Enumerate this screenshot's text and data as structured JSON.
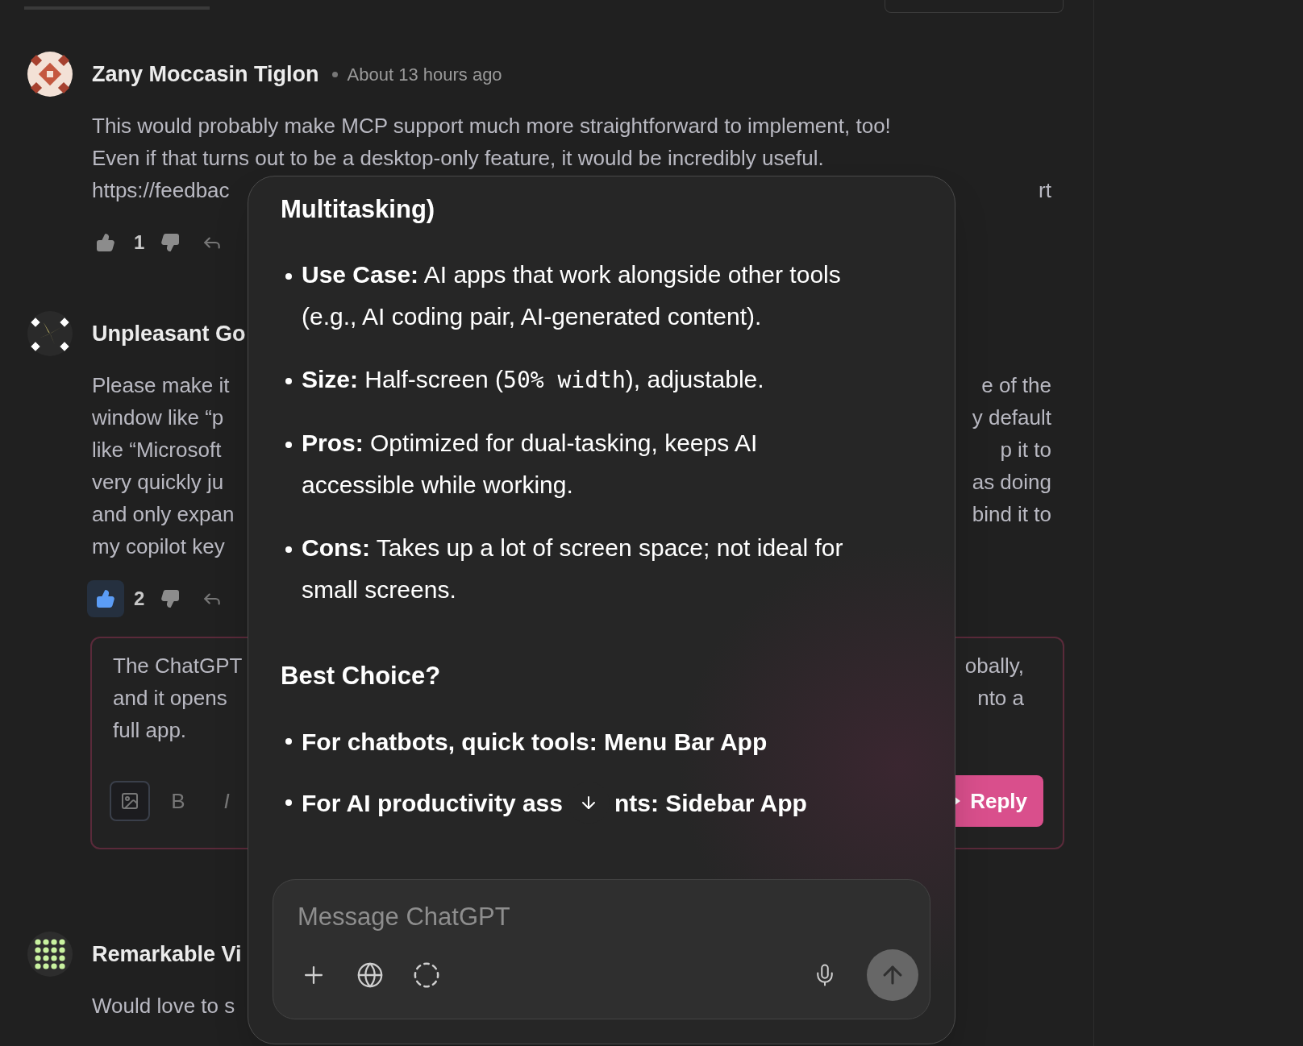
{
  "comments": [
    {
      "author": "Zany Moccasin Tiglon",
      "time": "About 13 hours ago",
      "lines": [
        {
          "left": "This would probably make MCP support much more straightforward to implement, too!"
        },
        {
          "left": "Even if that turns out to be a desktop-only feature, it would be incredibly useful."
        },
        {
          "left": "https://feedbac",
          "right": "rt"
        }
      ],
      "votes": {
        "count": "1",
        "upvoted": false
      }
    },
    {
      "author": "Unpleasant Go",
      "lines": [
        {
          "left": "Please make it",
          "right": "e of the"
        },
        {
          "left": "window like “p",
          "right": "y default"
        },
        {
          "left": "like “Microsoft",
          "right": "p it to"
        },
        {
          "left": "very quickly ju",
          "right": "as doing"
        },
        {
          "left": "and only expan",
          "right": "bind it to"
        },
        {
          "left": "my copilot key"
        }
      ],
      "votes": {
        "count": "2",
        "upvoted": true
      },
      "reply_editor": {
        "lines": [
          {
            "left": "The ChatGPT",
            "right": "obally,"
          },
          {
            "left": "and it opens",
            "right": "nto a"
          },
          {
            "left": "full app."
          }
        ],
        "toolbar": [
          {
            "kind": "image",
            "active": true
          },
          {
            "kind": "text",
            "label": "B",
            "active": false
          },
          {
            "kind": "italic",
            "label": "I",
            "active": false
          }
        ],
        "submit": "Reply"
      }
    },
    {
      "author": "Remarkable Vi",
      "lines": [
        {
          "left": "Would love to s"
        }
      ]
    }
  ],
  "chat": {
    "heading": "Multitasking)",
    "details": [
      {
        "label": "Use Case:",
        "parts": [
          {
            "kind": "plain",
            "text": " AI apps that work alongside other tools (e.g., AI coding pair, AI-generated content)."
          }
        ]
      },
      {
        "label": "Size:",
        "parts": [
          {
            "kind": "plain",
            "text": " Half-screen ("
          },
          {
            "kind": "code",
            "text": "50% width"
          },
          {
            "kind": "plain",
            "text": "), adjustable."
          }
        ]
      },
      {
        "label": "Pros:",
        "parts": [
          {
            "kind": "plain",
            "text": " Optimized for dual-tasking, keeps AI accessible while working."
          }
        ]
      },
      {
        "label": "Cons:",
        "parts": [
          {
            "kind": "plain",
            "text": " Takes up a lot of screen space; not ideal for small screens."
          }
        ]
      }
    ],
    "subheading": "Best Choice?",
    "choices": [
      {
        "segments": [
          "For chatbots, quick tools: Menu Bar App"
        ]
      },
      {
        "segments": [
          "For AI productivity ass",
          "nts: Sidebar App"
        ]
      }
    ],
    "composer": {
      "placeholder": "Message ChatGPT"
    }
  }
}
